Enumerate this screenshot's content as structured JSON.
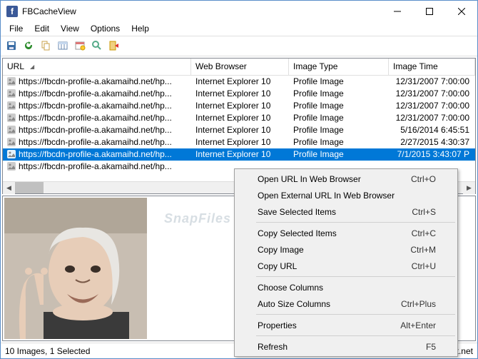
{
  "window": {
    "title": "FBCacheView"
  },
  "menu": {
    "file": "File",
    "edit": "Edit",
    "view": "View",
    "options": "Options",
    "help": "Help"
  },
  "columns": {
    "url": "URL",
    "browser": "Web Browser",
    "type": "Image Type",
    "time": "Image Time"
  },
  "rows": [
    {
      "url": "https://fbcdn-profile-a.akamaihd.net/hp...",
      "browser": "Internet Explorer 10",
      "type": "Profile Image",
      "time": "12/31/2007 7:00:00"
    },
    {
      "url": "https://fbcdn-profile-a.akamaihd.net/hp...",
      "browser": "Internet Explorer 10",
      "type": "Profile Image",
      "time": "12/31/2007 7:00:00"
    },
    {
      "url": "https://fbcdn-profile-a.akamaihd.net/hp...",
      "browser": "Internet Explorer 10",
      "type": "Profile Image",
      "time": "12/31/2007 7:00:00"
    },
    {
      "url": "https://fbcdn-profile-a.akamaihd.net/hp...",
      "browser": "Internet Explorer 10",
      "type": "Profile Image",
      "time": "12/31/2007 7:00:00"
    },
    {
      "url": "https://fbcdn-profile-a.akamaihd.net/hp...",
      "browser": "Internet Explorer 10",
      "type": "Profile Image",
      "time": "5/16/2014 6:45:51"
    },
    {
      "url": "https://fbcdn-profile-a.akamaihd.net/hp...",
      "browser": "Internet Explorer 10",
      "type": "Profile Image",
      "time": "2/27/2015 4:30:37"
    },
    {
      "url": "https://fbcdn-profile-a.akamaihd.net/hp...",
      "browser": "Internet Explorer 10",
      "type": "Profile Image",
      "time": "7/1/2015 3:43:07 P",
      "selected": true
    },
    {
      "url": "https://fbcdn-profile-a.akamaihd.net/hp...",
      "browser": "",
      "type": "",
      "time": ""
    }
  ],
  "context": {
    "open_url": "Open URL In Web Browser",
    "open_url_k": "Ctrl+O",
    "open_ext": "Open External URL In Web Browser",
    "save_sel": "Save Selected Items",
    "save_sel_k": "Ctrl+S",
    "copy_sel": "Copy Selected Items",
    "copy_sel_k": "Ctrl+C",
    "copy_img": "Copy Image",
    "copy_img_k": "Ctrl+M",
    "copy_url": "Copy URL",
    "copy_url_k": "Ctrl+U",
    "choose_cols": "Choose Columns",
    "auto_size": "Auto Size Columns",
    "auto_size_k": "Ctrl+Plus",
    "props": "Properties",
    "props_k": "Alt+Enter",
    "refresh": "Refresh",
    "refresh_k": "F5"
  },
  "status": {
    "left": "10 Images, 1 Selected",
    "right": "NirSoft Freeware.   http://www.nirsoft.net"
  },
  "watermark": "SnapFiles"
}
